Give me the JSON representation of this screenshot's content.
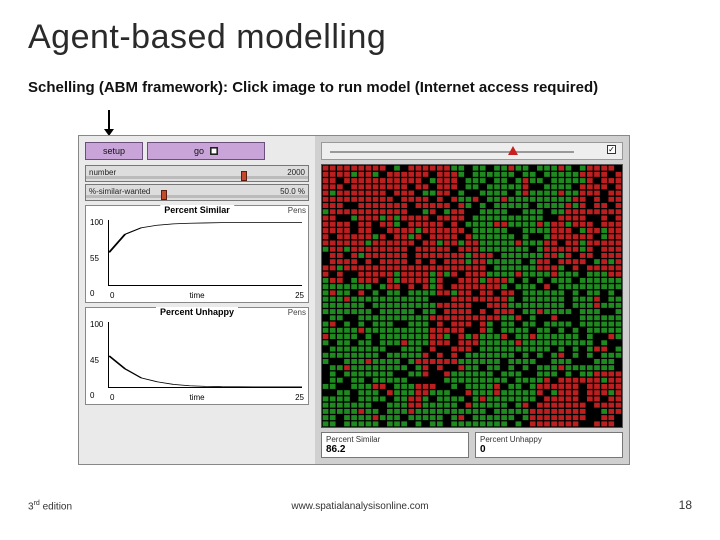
{
  "title": "Agent-based modelling",
  "subtitle": "Schelling (ABM framework): Click image to run model (Internet access required)",
  "controls": {
    "setup_label": "setup",
    "go_label": "go",
    "slider_number": {
      "label": "number",
      "value": "2000",
      "thumb_pct": 70
    },
    "slider_similar": {
      "label": "%-similar-wanted",
      "value": "50.0 %",
      "thumb_pct": 34
    }
  },
  "chart_data": [
    {
      "type": "line",
      "title": "Percent Similar",
      "pens_label": "Pens",
      "xlabel": "time",
      "ylabel": "",
      "xlim": [
        0,
        25
      ],
      "ylim": [
        0,
        100
      ],
      "y_ticks": [
        "100",
        "55",
        "0"
      ],
      "x_ticks": [
        "0",
        "25"
      ],
      "values_y_pct": [
        50,
        78,
        88,
        92,
        94,
        95,
        95.5,
        96,
        96,
        96,
        96,
        96,
        96
      ]
    },
    {
      "type": "line",
      "title": "Percent Unhappy",
      "pens_label": "Pens",
      "xlabel": "time",
      "ylabel": "",
      "xlim": [
        0,
        25
      ],
      "ylim": [
        0,
        100
      ],
      "y_ticks": [
        "100",
        "45",
        "0"
      ],
      "x_ticks": [
        "0",
        "25"
      ],
      "values_y_pct": [
        48,
        28,
        14,
        8,
        4,
        2,
        1,
        0.5,
        0.3,
        0.2,
        0.1,
        0.1,
        0.1
      ]
    }
  ],
  "speed": {
    "checkbox_label": "",
    "checked": true
  },
  "monitors": {
    "percent_similar": {
      "label": "Percent Similar",
      "value": "86.2"
    },
    "percent_unhappy": {
      "label": "Percent Unhappy",
      "value": "0"
    }
  },
  "footer": {
    "edition_prefix": "3",
    "edition_suffix": "rd",
    "edition_word": " edition",
    "url": "www.spatialanalysisonline.com",
    "page": "18"
  },
  "colors": {
    "fg_red": "#bb1f1f",
    "fg_green": "#1f8a1f",
    "bg_world": "#000000"
  }
}
